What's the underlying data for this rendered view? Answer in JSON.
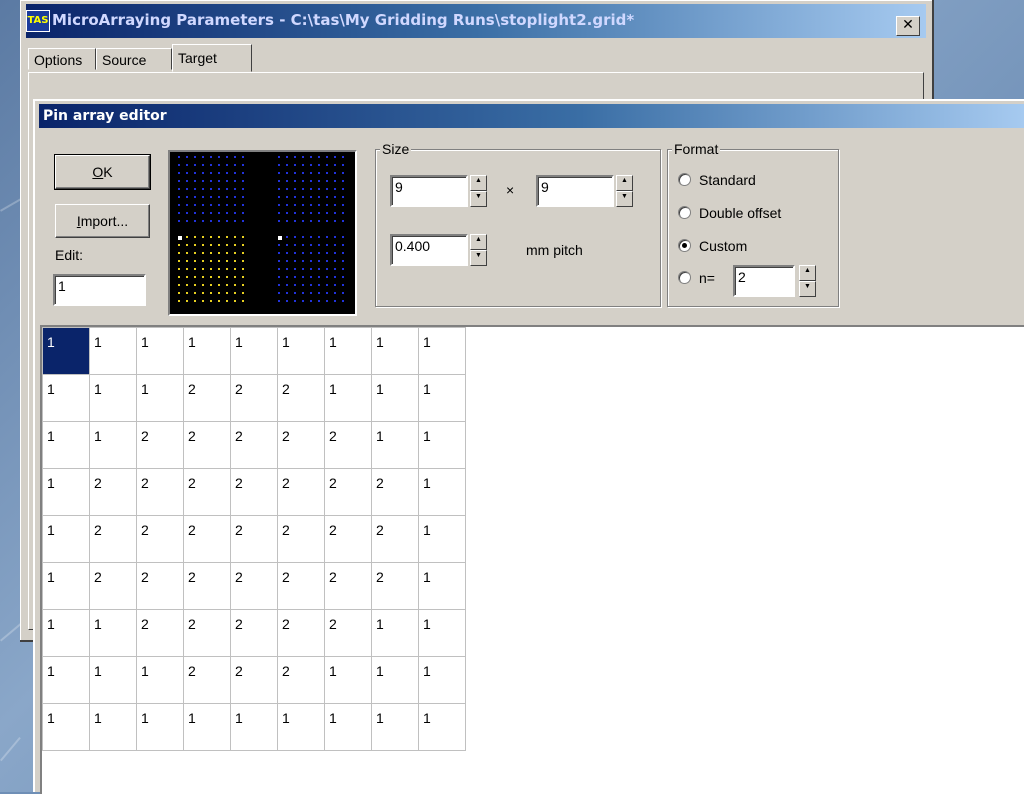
{
  "window": {
    "title": "MicroArraying Parameters - C:\\tas\\My Gridding Runs\\stoplight2.grid*",
    "icon_text": "TAS",
    "close_glyph": "✕",
    "tabs": [
      {
        "label": "Options",
        "active": false
      },
      {
        "label": "Source",
        "active": false
      },
      {
        "label": "Target",
        "active": true
      }
    ]
  },
  "dialog": {
    "title": "Pin array editor",
    "ok_button": {
      "mnemonic": "O",
      "rest": "K"
    },
    "import_button": {
      "mnemonic": "I",
      "rest": "mport..."
    },
    "edit_label": "Edit:",
    "edit_value": "1",
    "size_group": {
      "title": "Size",
      "rows_value": "9",
      "times": "×",
      "cols_value": "9",
      "pitch_value": "0.400",
      "pitch_unit": "mm pitch"
    },
    "format_group": {
      "title": "Format",
      "options": [
        {
          "label": "Standard",
          "checked": false
        },
        {
          "label": "Double offset",
          "checked": false
        },
        {
          "label": "Custom",
          "checked": true
        }
      ],
      "n_label": "n=",
      "n_checked": false,
      "n_value": "2"
    },
    "colors": {
      "value_1": "#2233dd",
      "value_2": "#e8d020",
      "highlight": "#ffffff"
    }
  },
  "pin_grid": [
    [
      "1",
      "1",
      "1",
      "1",
      "1",
      "1",
      "1",
      "1",
      "1"
    ],
    [
      "1",
      "1",
      "1",
      "2",
      "2",
      "2",
      "1",
      "1",
      "1"
    ],
    [
      "1",
      "1",
      "2",
      "2",
      "2",
      "2",
      "2",
      "1",
      "1"
    ],
    [
      "1",
      "2",
      "2",
      "2",
      "2",
      "2",
      "2",
      "2",
      "1"
    ],
    [
      "1",
      "2",
      "2",
      "2",
      "2",
      "2",
      "2",
      "2",
      "1"
    ],
    [
      "1",
      "2",
      "2",
      "2",
      "2",
      "2",
      "2",
      "2",
      "1"
    ],
    [
      "1",
      "1",
      "2",
      "2",
      "2",
      "2",
      "2",
      "1",
      "1"
    ],
    [
      "1",
      "1",
      "1",
      "2",
      "2",
      "2",
      "1",
      "1",
      "1"
    ],
    [
      "1",
      "1",
      "1",
      "1",
      "1",
      "1",
      "1",
      "1",
      "1"
    ]
  ],
  "selected_cell": [
    0,
    0
  ]
}
